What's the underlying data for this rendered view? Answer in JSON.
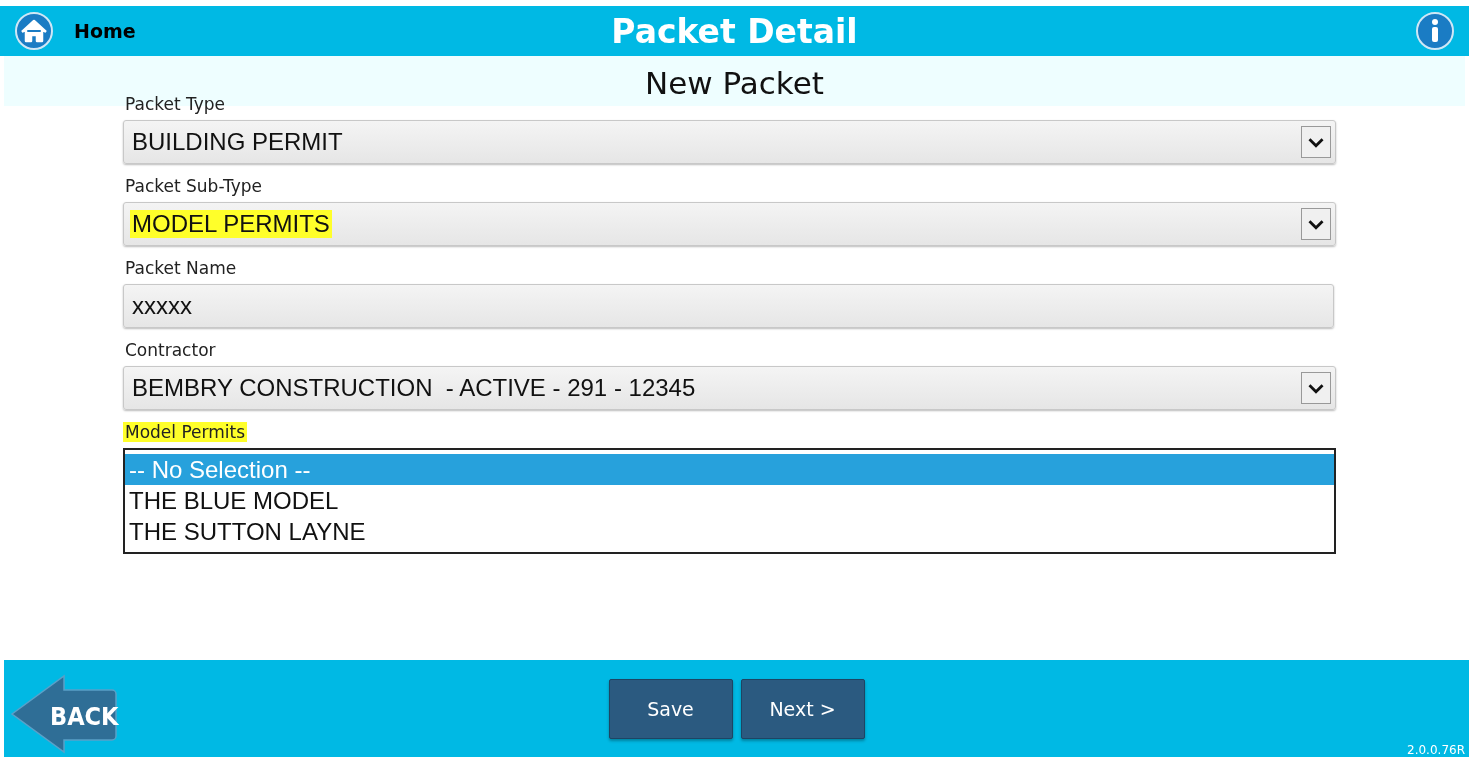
{
  "header": {
    "home_label": "Home",
    "title": "Packet Detail"
  },
  "subtitle": "New Packet",
  "fields": [
    {
      "kind": "select",
      "label": "Packet Type",
      "label_highlighted": false,
      "value": "BUILDING PERMIT",
      "value_highlighted": false
    },
    {
      "kind": "select",
      "label": "Packet Sub-Type",
      "label_highlighted": false,
      "value": "MODEL PERMITS",
      "value_highlighted": true
    },
    {
      "kind": "text",
      "label": "Packet Name",
      "label_highlighted": false,
      "value": "xxxxx",
      "value_highlighted": false
    },
    {
      "kind": "select",
      "label": "Contractor",
      "label_highlighted": false,
      "value": "BEMBRY CONSTRUCTION  - ACTIVE - 291 - 12345",
      "value_highlighted": false
    },
    {
      "kind": "listbox",
      "label": "Model Permits",
      "label_highlighted": true,
      "options": [
        {
          "label": "-- No Selection --",
          "selected": true
        },
        {
          "label": "THE BLUE MODEL",
          "selected": false
        },
        {
          "label": "THE SUTTON LAYNE",
          "selected": false
        }
      ]
    }
  ],
  "footer": {
    "back_label": "BACK",
    "buttons": [
      "Save",
      "Next >"
    ],
    "version": "2.0.0.76R"
  }
}
